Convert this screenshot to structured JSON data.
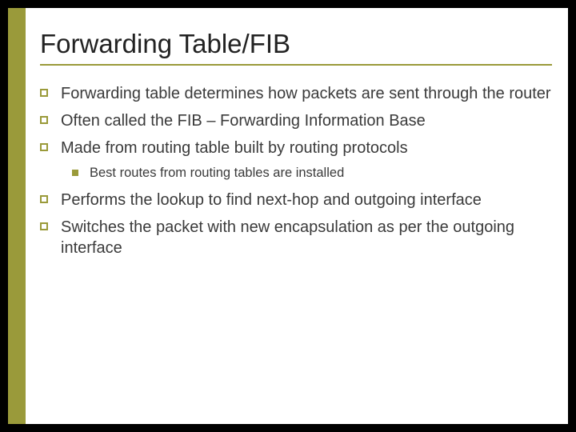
{
  "slide": {
    "title": "Forwarding Table/FIB",
    "bullets": {
      "b0": "Forwarding table determines how packets are sent through the router",
      "b1": "Often called the FIB – Forwarding Information Base",
      "b2": "Made from routing table built by routing protocols",
      "b2_sub0": "Best routes from routing tables are installed",
      "b3": "Performs the lookup to find next-hop and outgoing interface",
      "b4": "Switches the packet with new encapsulation as per the outgoing interface"
    }
  }
}
